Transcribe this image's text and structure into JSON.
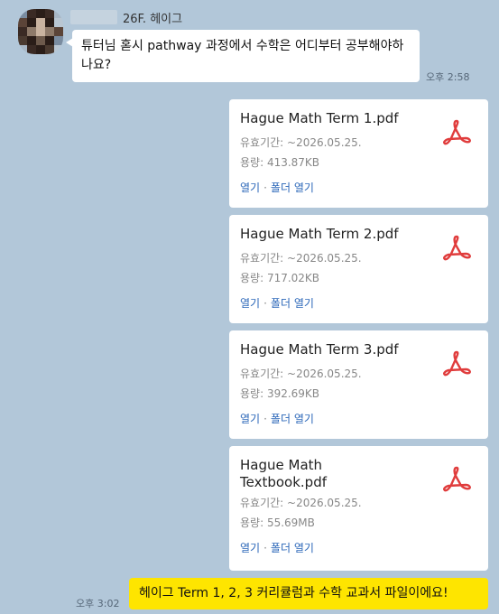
{
  "incoming": {
    "sender_name": "26F. 헤이그",
    "message": "튜터님 혿시 pathway 과정에서 수학은 어디부터 공부해야하나요?",
    "time": "오후 2:58"
  },
  "files": [
    {
      "name": "Hague Math Term 1.pdf",
      "expiry": "유효기간: ~2026.05.25.",
      "size": "용량: 413.87KB",
      "open": "열기",
      "separator": "·",
      "open_folder": "폴더 열기"
    },
    {
      "name": "Hague Math Term 2.pdf",
      "expiry": "유효기간: ~2026.05.25.",
      "size": "용량: 717.02KB",
      "open": "열기",
      "separator": "·",
      "open_folder": "폴더 열기"
    },
    {
      "name": "Hague Math Term 3.pdf",
      "expiry": "유효기간: ~2026.05.25.",
      "size": "용량: 392.69KB",
      "open": "열기",
      "separator": "·",
      "open_folder": "폴더 열기"
    },
    {
      "name": "Hague Math Textbook.pdf",
      "expiry": "유효기간: ~2026.05.25.",
      "size": "용량: 55.69MB",
      "open": "열기",
      "separator": "·",
      "open_folder": "폴더 열기"
    }
  ],
  "outgoing": {
    "message": "헤이그 Term 1, 2, 3 커리큘럼과 수학 교과서 파일이에요!",
    "time": "오후 3:02"
  },
  "colors": {
    "chat_background": "#b2c7d9",
    "outgoing_bubble": "#fee500",
    "incoming_bubble": "#ffffff",
    "link": "#2a66b8",
    "pdf_icon": "#e03c3c"
  },
  "icons": {
    "file_type": "pdf-acrobat-icon"
  }
}
